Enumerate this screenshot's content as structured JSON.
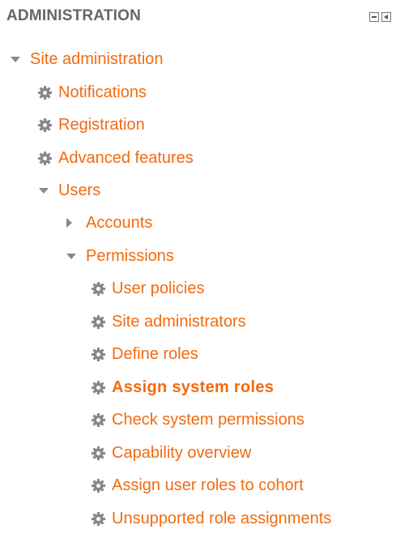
{
  "block": {
    "title": "ADMINISTRATION"
  },
  "tree": {
    "site_admin": "Site administration",
    "notifications": "Notifications",
    "registration": "Registration",
    "advanced_features": "Advanced features",
    "users": "Users",
    "accounts": "Accounts",
    "permissions": "Permissions",
    "user_policies": "User policies",
    "site_administrators": "Site administrators",
    "define_roles": "Define roles",
    "assign_system_roles": "Assign system roles",
    "check_system_permissions": "Check system permissions",
    "capability_overview": "Capability overview",
    "assign_user_roles_to_cohort": "Assign user roles to cohort",
    "unsupported_role_assignments": "Unsupported role assignments"
  },
  "icons": {
    "expanded": "caret-down-icon",
    "collapsed": "caret-right-icon",
    "settings": "gear-icon",
    "minimize": "minimize-icon",
    "dock": "dock-icon"
  },
  "colors": {
    "link": "#f26b0f",
    "header": "#666666",
    "icon": "#888888"
  }
}
